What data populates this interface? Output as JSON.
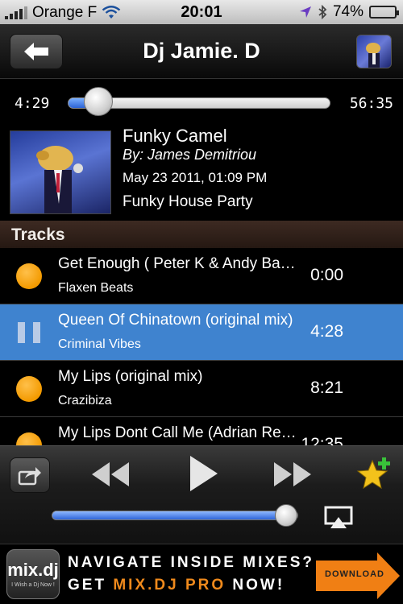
{
  "status_bar": {
    "carrier": "Orange F",
    "time": "20:01",
    "battery": "74%",
    "battery_level": 0.74
  },
  "nav": {
    "title": "Dj Jamie. D",
    "back_icon": "left-arrow-icon"
  },
  "playback": {
    "elapsed": "4:29",
    "total": "56:35",
    "progress": 0.08
  },
  "mix": {
    "title": "Funky Camel",
    "artist": "By: James Demitriou",
    "date": "May 23 2011, 01:09 PM",
    "genre": "Funky House Party"
  },
  "tracks_header": "Tracks",
  "tracks": [
    {
      "title": "Get Enough ( Peter K & Andy Baxter Remix)",
      "artist": "Flaxen Beats",
      "duration": "0:00",
      "state": "queued"
    },
    {
      "title": "Queen Of Chinatown (original mix)",
      "artist": "Criminal Vibes",
      "duration": "4:28",
      "state": "playing"
    },
    {
      "title": "My Lips (original mix)",
      "artist": "Crazibiza",
      "duration": "8:21",
      "state": "queued"
    },
    {
      "title": "My Lips Dont Call Me (Adrian Remix)",
      "artist": "",
      "duration": "12:35",
      "state": "queued"
    }
  ],
  "volume": {
    "level": 0.95
  },
  "ad": {
    "logo_text": "mix.dj",
    "logo_sub": "I Wish a Dj Now !",
    "line1": "NAVIGATE INSIDE MIXES?",
    "line2_pre": "GET ",
    "line2_brand": "MIX.DJ PRO",
    "line2_post": " NOW!",
    "download": "DOWNLOAD"
  },
  "colors": {
    "accent_blue": "#3f83cf",
    "orange": "#f39a00",
    "section_header": "#2f201a"
  }
}
